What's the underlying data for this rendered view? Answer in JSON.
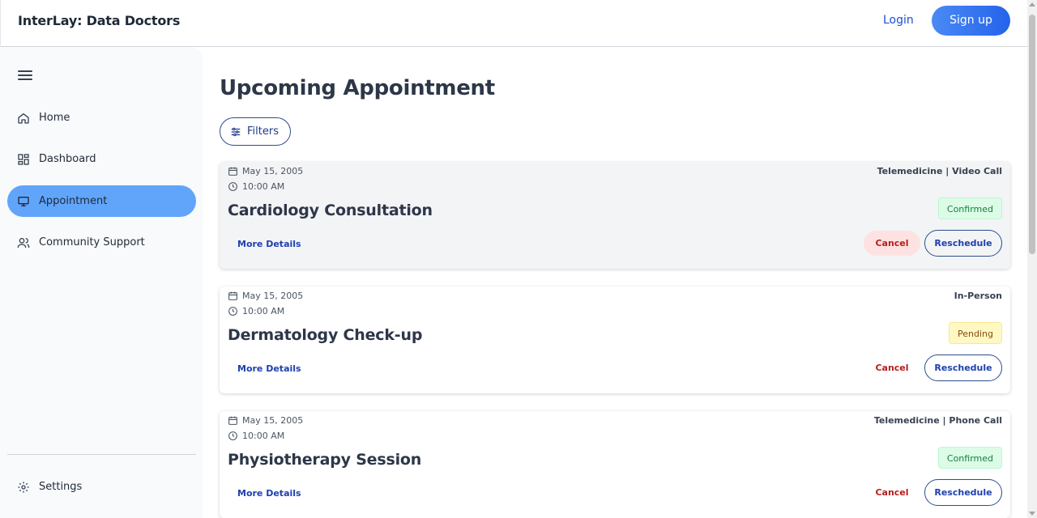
{
  "header": {
    "brand": "InterLay: Data Doctors",
    "login_label": "Login",
    "signup_label": "Sign up"
  },
  "sidebar": {
    "menu_icon": "hamburger-icon",
    "items": [
      {
        "label": "Home",
        "icon": "home-icon",
        "active": false
      },
      {
        "label": "Dashboard",
        "icon": "dashboard-icon",
        "active": false
      },
      {
        "label": "Appointment",
        "icon": "monitor-icon",
        "active": true
      },
      {
        "label": "Community Support",
        "icon": "users-icon",
        "active": false
      }
    ],
    "settings_label": "Settings",
    "accent_color": "#60a5fa"
  },
  "main": {
    "title": "Upcoming Appointment",
    "filters_label": "Filters"
  },
  "appointments": [
    {
      "date": "May 15, 2005",
      "time": "10:00 AM",
      "visit_type": "Telemedicine | Video Call",
      "title": "Cardiology Consultation",
      "status": "Confirmed",
      "more_label": "More Details",
      "cancel_label": "Cancel",
      "reschedule_label": "Reschedule"
    },
    {
      "date": "May 15, 2005",
      "time": "10:00 AM",
      "visit_type": "In-Person",
      "title": "Dermatology Check-up",
      "status": "Pending",
      "more_label": "More Details",
      "cancel_label": "Cancel",
      "reschedule_label": "Reschedule"
    },
    {
      "date": "May 15, 2005",
      "time": "10:00 AM",
      "visit_type": "Telemedicine | Phone Call",
      "title": "Physiotherapy Session",
      "status": "Confirmed",
      "more_label": "More Details",
      "cancel_label": "Cancel",
      "reschedule_label": "Reschedule"
    }
  ],
  "colors": {
    "confirmed": "#15803d",
    "pending": "#854d0e",
    "cancel": "#b91c1c",
    "primary": "#2563eb"
  }
}
